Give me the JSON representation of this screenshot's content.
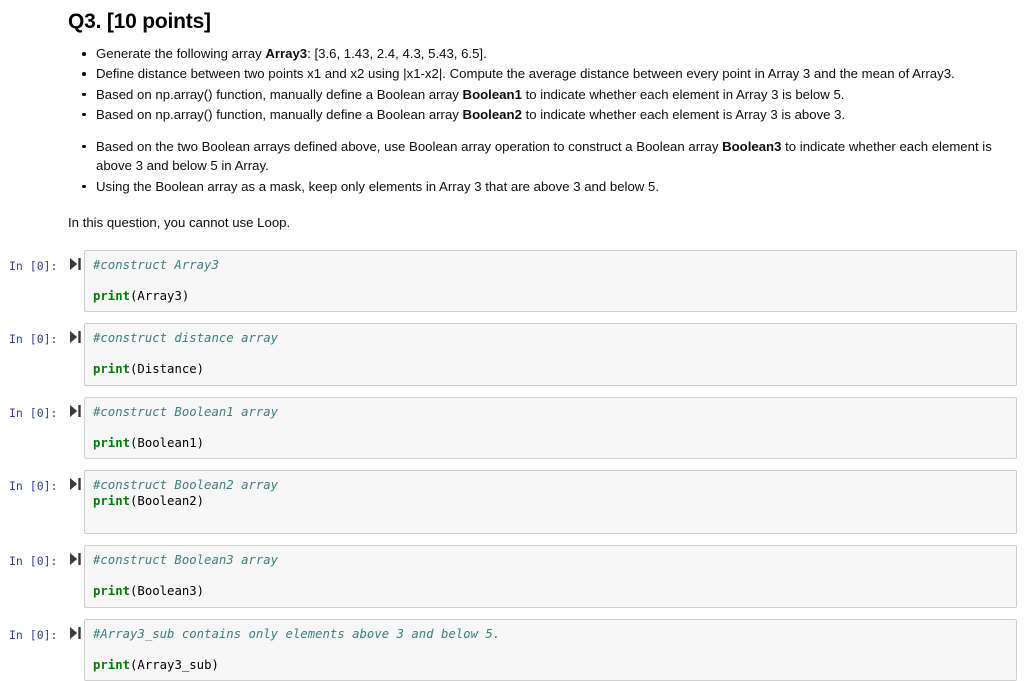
{
  "question": {
    "title": "Q3. [10 points]",
    "bullets": [
      {
        "segments": [
          {
            "text": "Generate the following array ",
            "bold": false
          },
          {
            "text": "Array3",
            "bold": true
          },
          {
            "text": ": [3.6, 1.43, 2.4, 4.3, 5.43, 6.5].",
            "bold": false
          }
        ],
        "spaced_above": false
      },
      {
        "segments": [
          {
            "text": "Define distance between two points x1 and x2 using |x1-x2|. Compute the average distance between every point in Array 3 and the mean of Array3.",
            "bold": false
          }
        ],
        "spaced_above": false
      },
      {
        "segments": [
          {
            "text": "Based on np.array() function, manually define a Boolean array ",
            "bold": false
          },
          {
            "text": "Boolean1",
            "bold": true
          },
          {
            "text": " to indicate whether each element in Array 3 is below 5.",
            "bold": false
          }
        ],
        "spaced_above": false
      },
      {
        "segments": [
          {
            "text": "Based on np.array() function, manually define a Boolean array ",
            "bold": false
          },
          {
            "text": "Boolean2",
            "bold": true
          },
          {
            "text": " to indicate whether each element is Array 3 is above 3.",
            "bold": false
          }
        ],
        "spaced_above": false
      },
      {
        "segments": [
          {
            "text": "Based on the two Boolean arrays defined above, use Boolean array operation to construct a Boolean array ",
            "bold": false
          },
          {
            "text": "Boolean3",
            "bold": true
          },
          {
            "text": " to indicate whether each element is above 3 and below 5 in Array.",
            "bold": false
          }
        ],
        "spaced_above": true
      },
      {
        "segments": [
          {
            "text": "Using the Boolean array as a mask, keep only elements in Array 3 that are above 3 and below 5.",
            "bold": false
          }
        ],
        "spaced_above": false
      }
    ],
    "note": "In this question, you cannot use Loop."
  },
  "notebook": {
    "prompt_label": "In [0]:",
    "run_icon_name": "run-cell-icon",
    "cells": [
      {
        "comment": "#construct Array3",
        "code_keyword": "print",
        "code_rest": "(Array3)",
        "blank_between": true,
        "trailing_blank": false
      },
      {
        "comment": "#construct distance array",
        "code_keyword": "print",
        "code_rest": "(Distance)",
        "blank_between": true,
        "trailing_blank": false
      },
      {
        "comment": "#construct Boolean1 array",
        "code_keyword": "print",
        "code_rest": "(Boolean1)",
        "blank_between": true,
        "trailing_blank": false
      },
      {
        "comment": "#construct Boolean2 array",
        "code_keyword": "print",
        "code_rest": "(Boolean2)",
        "blank_between": false,
        "trailing_blank": true
      },
      {
        "comment": "#construct Boolean3 array",
        "code_keyword": "print",
        "code_rest": "(Boolean3)",
        "blank_between": true,
        "trailing_blank": false
      },
      {
        "comment": "#Array3_sub contains only elements above 3 and below 5.",
        "code_keyword": "print",
        "code_rest": "(Array3_sub)",
        "blank_between": true,
        "trailing_blank": false
      }
    ]
  },
  "colors": {
    "comment": "#3f7f7f",
    "keyword": "#008000",
    "prompt": "#303f9f",
    "cell_background": "#f7f7f7",
    "cell_border": "#cfcfcf"
  }
}
